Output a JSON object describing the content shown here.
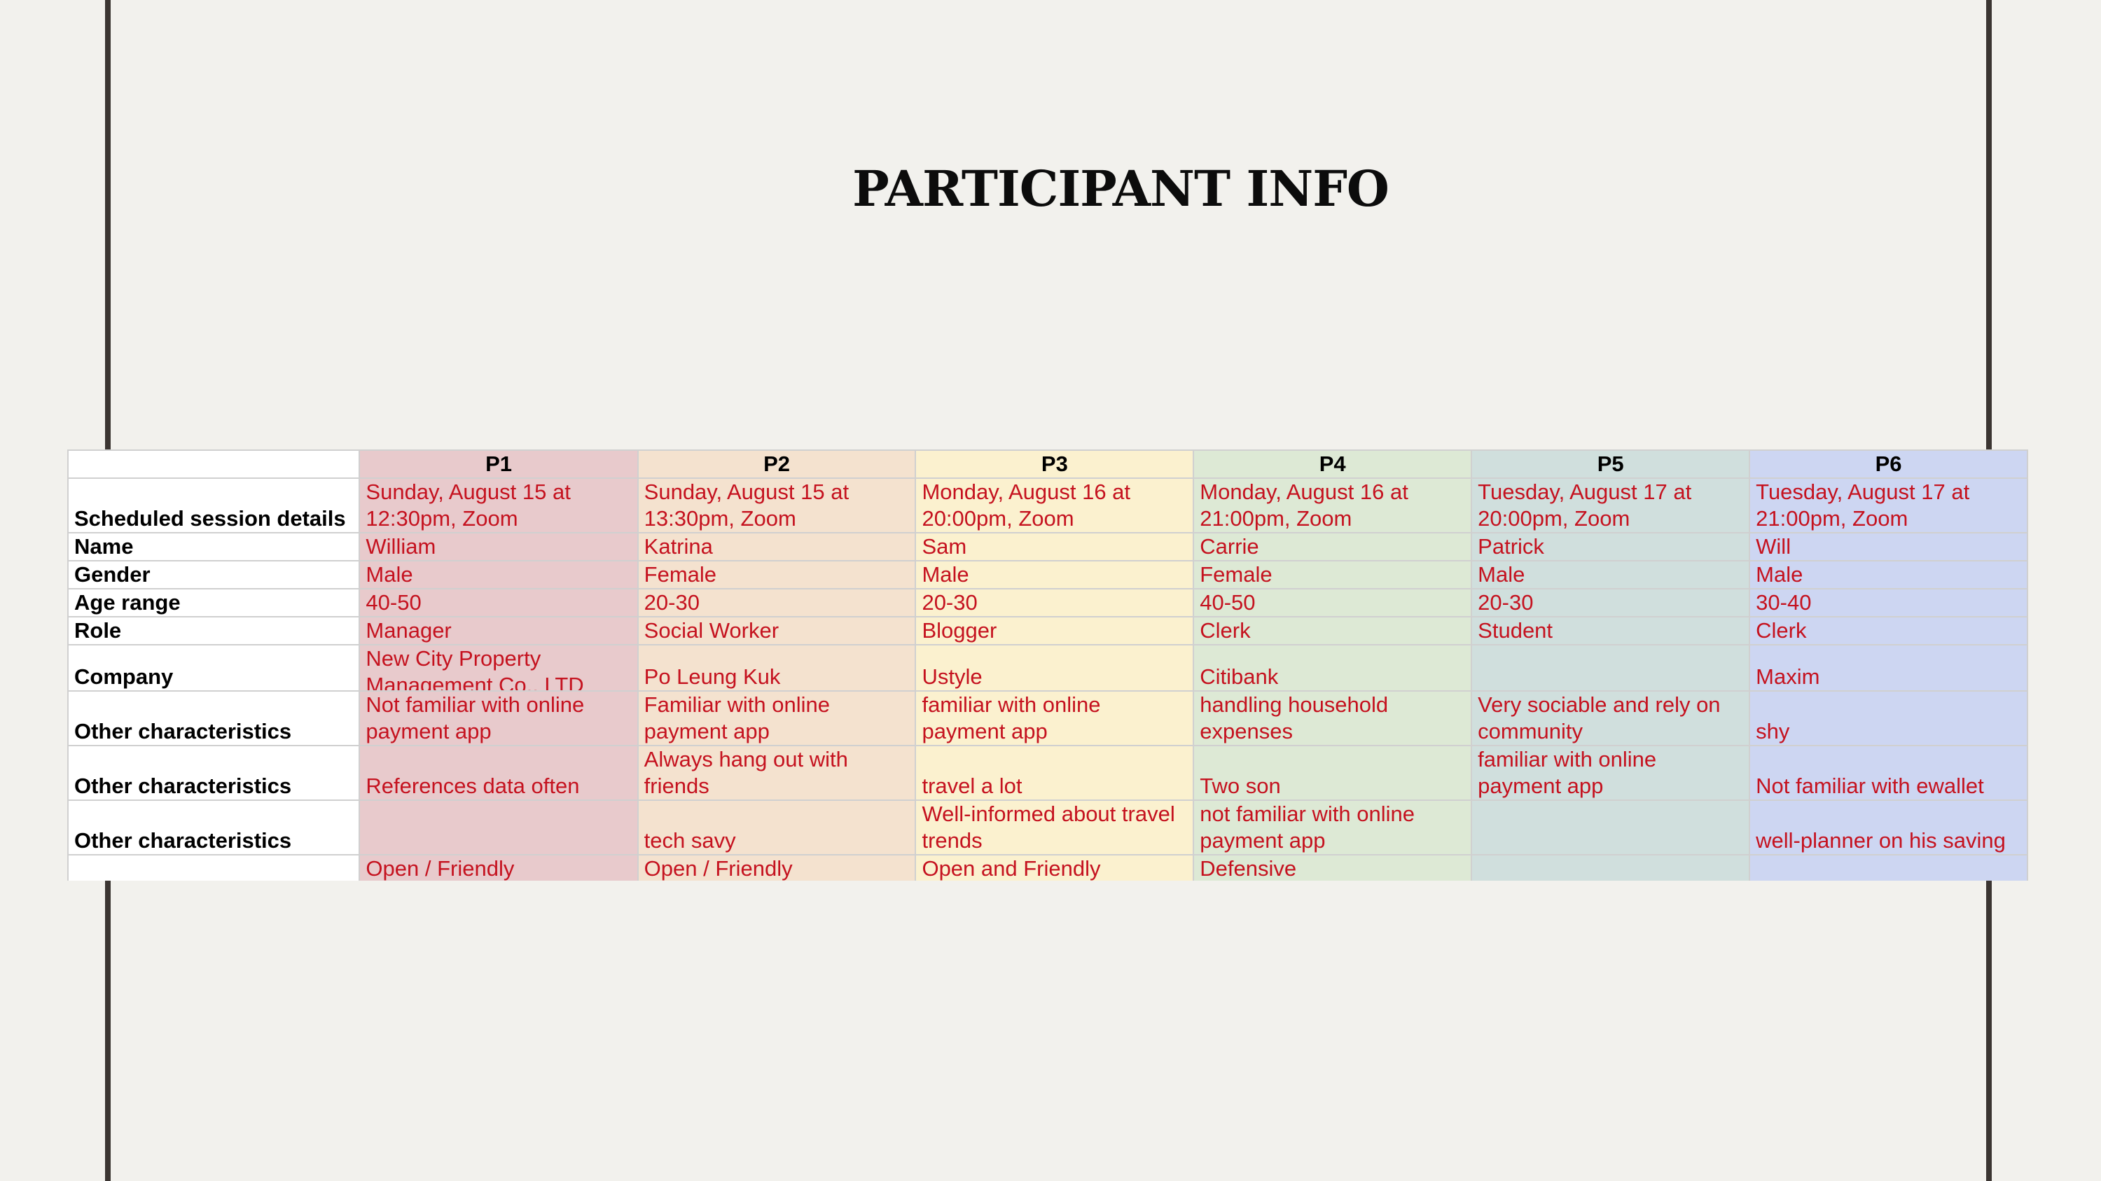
{
  "title": "PARTICIPANT INFO",
  "colors": {
    "background": "#f2f1ed",
    "border_lines": "#3b3532",
    "cell_text": "#c5121f",
    "p1": "#e8cacc",
    "p2": "#f4e2cf",
    "p3": "#fbf1cf",
    "p4": "#dde9d5",
    "p5": "#d0dfdd",
    "p6": "#cdd6f2"
  },
  "table": {
    "headers": [
      "P1",
      "P2",
      "P3",
      "P4",
      "P5",
      "P6"
    ],
    "rows": [
      {
        "label": "Scheduled session details",
        "cells": [
          "Sunday, August 15 at 12:30pm, Zoom",
          "Sunday, August 15 at 13:30pm, Zoom",
          "Monday, August 16 at 20:00pm, Zoom",
          "Monday, August 16 at 21:00pm, Zoom",
          "Tuesday, August 17 at 20:00pm, Zoom",
          "Tuesday, August 17 at 21:00pm, Zoom"
        ]
      },
      {
        "label": "Name",
        "cells": [
          "William",
          "Katrina",
          "Sam",
          "Carrie",
          "Patrick",
          "Will"
        ]
      },
      {
        "label": "Gender",
        "cells": [
          "Male",
          "Female",
          "Male",
          "Female",
          "Male",
          "Male"
        ]
      },
      {
        "label": "Age range",
        "cells": [
          "40-50",
          "20-30",
          "20-30",
          "40-50",
          "20-30",
          "30-40"
        ]
      },
      {
        "label": "Role",
        "cells": [
          "Manager",
          "Social Worker",
          "Blogger",
          "Clerk",
          "Student",
          "Clerk"
        ]
      },
      {
        "label": "Company",
        "cells": [
          "New City Property Management Co., LTD",
          "Po Leung Kuk",
          "Ustyle",
          "Citibank",
          "",
          "Maxim"
        ]
      },
      {
        "label": "Other characteristics",
        "cells": [
          "Not familiar with online payment app",
          "Familiar with online payment app",
          "familiar with online payment app",
          "handling household expenses",
          "Very sociable and rely on community",
          "shy"
        ]
      },
      {
        "label": "Other characteristics",
        "cells": [
          "References data often",
          "Always hang out with friends",
          "travel a lot",
          "Two son",
          "familiar with online payment app",
          "Not familiar with ewallet"
        ]
      },
      {
        "label": "Other characteristics",
        "cells": [
          "",
          "tech savy",
          "Well-informed about travel trends",
          "not familiar with online payment app",
          "",
          "well-planner on his saving"
        ]
      },
      {
        "label": "",
        "cells": [
          "Open / Friendly",
          "Open / Friendly",
          "Open and Friendly",
          "Defensive",
          "",
          ""
        ]
      }
    ]
  }
}
